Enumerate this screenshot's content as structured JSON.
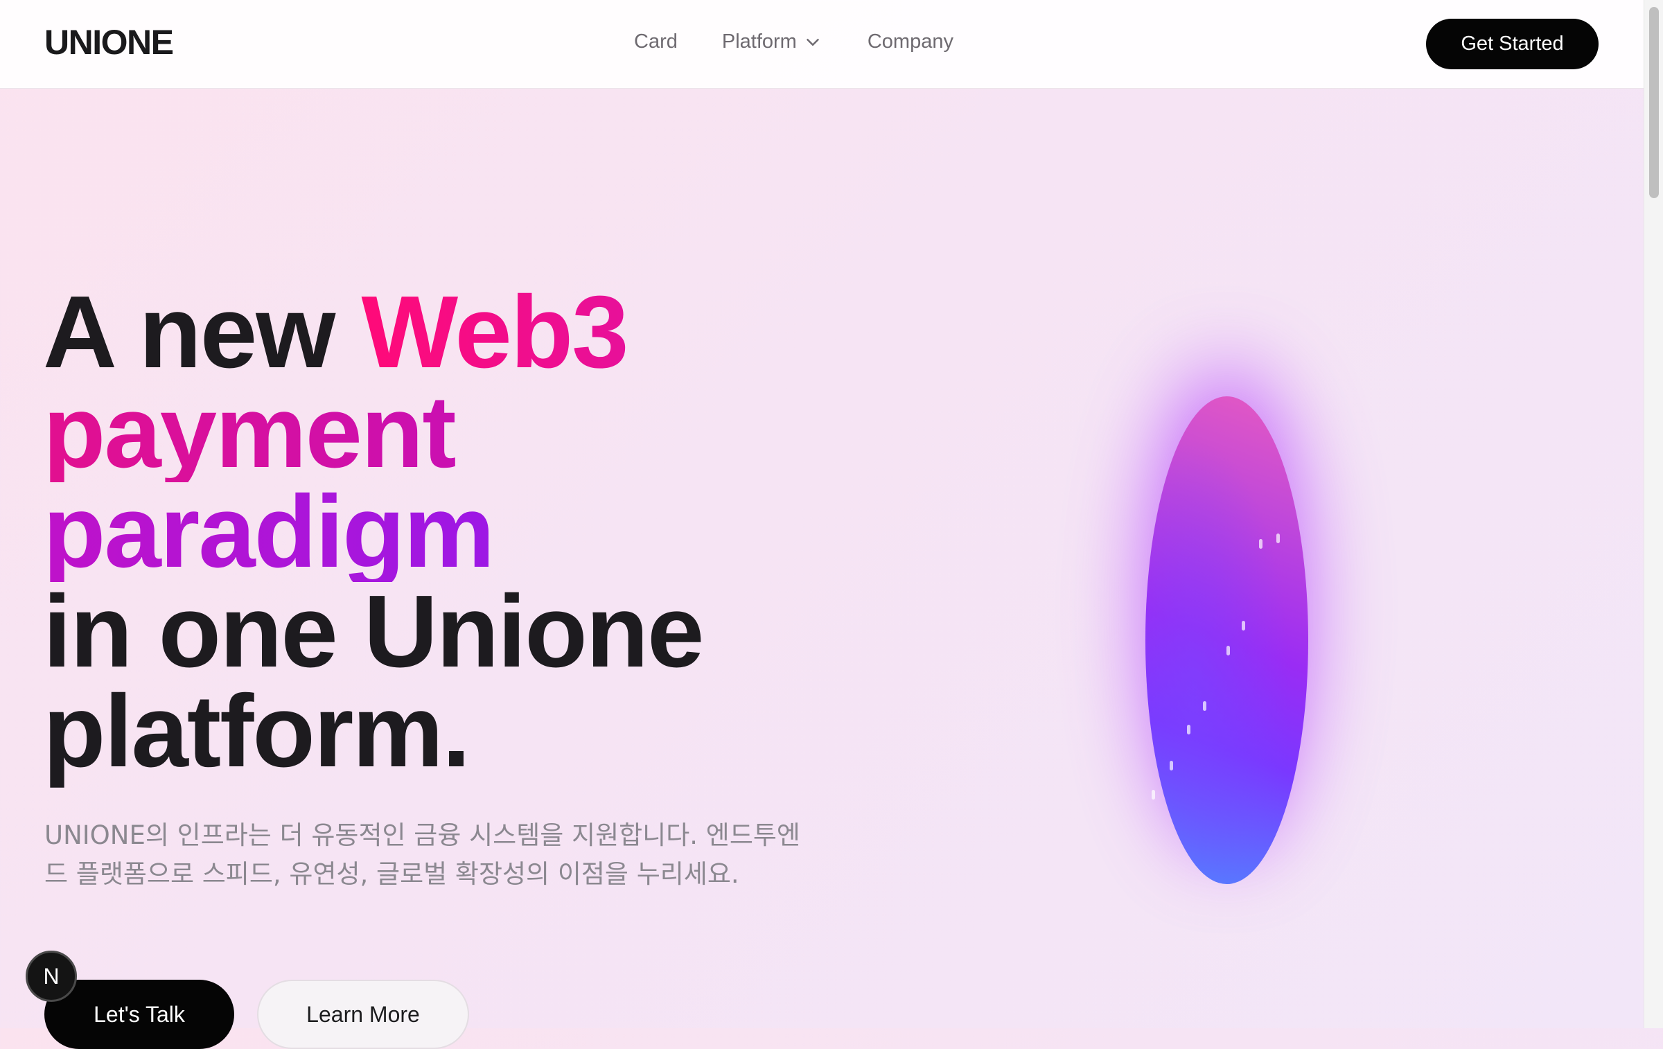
{
  "nav": {
    "logo": "UNIONE",
    "links": {
      "card": "Card",
      "platform": "Platform",
      "company": "Company"
    },
    "cta": "Get Started"
  },
  "hero": {
    "title": {
      "line1_plain": "A new ",
      "line1_accent": "Web3",
      "line2": "payment",
      "line3": "paradigm",
      "line4": "in one Unione",
      "line5": "platform."
    },
    "subtitle": "UNIONE의 인프라는 더 유동적인 금융 시스템을 지원합니다. 엔드투엔드 플랫폼으로 스피드, 유연성, 글로벌 확장성의 이점을 누리세요.",
    "buttons": {
      "primary": "Let's Talk",
      "secondary": "Learn More"
    }
  },
  "badge": {
    "letter": "N"
  },
  "icons": {
    "platform_dropdown": "chevron-down-icon"
  },
  "colors": {
    "accent_pink": "#ff0a78",
    "accent_magenta": "#bb10c6",
    "accent_purple": "#8d1af2",
    "button_dark": "#050505"
  }
}
